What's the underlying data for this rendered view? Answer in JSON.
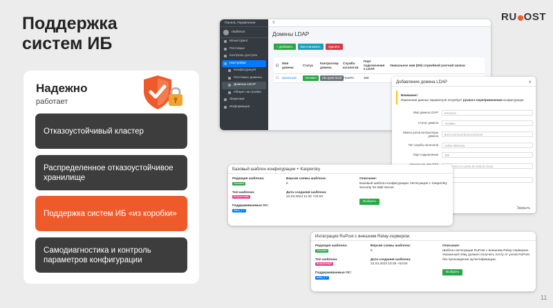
{
  "slide": {
    "title_line1": "Поддержка",
    "title_line2": "систем ИБ",
    "logo_left": "RU",
    "logo_right": "OST",
    "page_number": "11"
  },
  "card": {
    "title": "Надежно",
    "subtitle": "работает",
    "features": [
      "Отказоустойчивый кластер",
      "Распределенное отказоустойчивое хранилище",
      "Поддержка  систем ИБ «из коробки»",
      "Самодиагностика и контроль параметров конфигурации"
    ]
  },
  "admin": {
    "app_title": "Панель Управления",
    "topbar_icon": "≡",
    "user": "rladisinar",
    "nav": [
      {
        "label": "Мониторинг",
        "type": "item"
      },
      {
        "label": "Почтовые",
        "type": "item"
      },
      {
        "label": "Контроль доступа",
        "type": "item"
      },
      {
        "label": "Настройки",
        "type": "active"
      },
      {
        "label": "Конфигурация",
        "type": "sub"
      },
      {
        "label": "Почтовые домены",
        "type": "sub"
      },
      {
        "label": "Домены LDAP",
        "type": "cur"
      },
      {
        "label": "Общие настройки",
        "type": "sub"
      },
      {
        "label": "Лицензии",
        "type": "item"
      },
      {
        "label": "Информация",
        "type": "item"
      }
    ],
    "page_title": "Домены LDAP",
    "buttons": {
      "add": "+ Добавить",
      "restore": "Восстановить",
      "delete": "Удалить"
    },
    "table": {
      "headers": [
        "Имя домена",
        "Статус",
        "Контроллер домена",
        "Служба каталогов",
        "Порт подключения к LDAP",
        "Уникальное имя (DN) служебной учетной записи"
      ],
      "rows": [
        [
          "rpost.local",
          "Активен",
          "rdc.rpost.local",
          "FreeIPA",
          "389",
          ""
        ]
      ]
    }
  },
  "modal": {
    "title": "Добавление  домена LDAP",
    "close": "×",
    "warn_title": "Внимание!",
    "warn_text_a": "Изменение данных параметров потребует ",
    "warn_text_bold": "ручного переприменения",
    "warn_text_b": " конфигурации",
    "fields": [
      {
        "label": "Имя домена LDAP",
        "value": "test.local"
      },
      {
        "label": "Статус домена",
        "value": "Активен"
      },
      {
        "label": "Имена узлов контроллера домена",
        "value": "dc01.test.local dc02.test.local"
      },
      {
        "label": "Тип службы каталогов",
        "value": "Active Directory"
      },
      {
        "label": "Порт подключения",
        "value": "389"
      },
      {
        "label": "Уникальное имя (DN) служебной учетной записи",
        "value": "cn=service,cn=users,dc=test,dc=local"
      },
      {
        "label": "Пароль",
        "value": ""
      }
    ],
    "footer_button": "Закрыть"
  },
  "template1": {
    "title": "Базовый шаблон конфигурации + Kaspersky",
    "edition_label": "Редакция шаблона:",
    "edition_value": "Standard",
    "version_label": "Версия схемы шаблона:",
    "version_value": "5",
    "type_label": "Тип шаблона:",
    "type_value": "Встроенный",
    "created_label": "Дата создания шаблона:",
    "created_value": "22.03.2023 11:32 +03:00",
    "os_label": "Поддерживаемые ОС:",
    "os_value": "astra_1.7",
    "desc_label": "Описание:",
    "desc_value": "Базовый шаблон конфигурации. Интеграция с Kaspersky Security for Mail Server.",
    "select_button": "Выбрать"
  },
  "template2": {
    "title": "Интеграция RuPost с внешним Relay-сервером.",
    "edition_label": "Редакция шаблона:",
    "edition_value": "Standard",
    "version_label": "Версия схемы шаблона:",
    "version_value": "5",
    "type_label": "Тип шаблона:",
    "type_value": "Встроенный",
    "created_label": "Дата создания шаблона:",
    "created_value": "22.03.2023 10:39 +03:00",
    "os_label": "Поддерживаемые ОС:",
    "os_value": "astra_1.7",
    "desc_label": "Описание:",
    "desc_value": "Шаблон интеграции RuPost с внешним Relay-сервером. Указанный relay должен получать почту от узлов RuPost без прохождения аутентификации.",
    "select_button": "Выбрать"
  },
  "colors": {
    "accent": "#ef5a2b",
    "dark_card": "#3d3d3d",
    "sidebar": "#343a40",
    "success": "#28a745"
  }
}
